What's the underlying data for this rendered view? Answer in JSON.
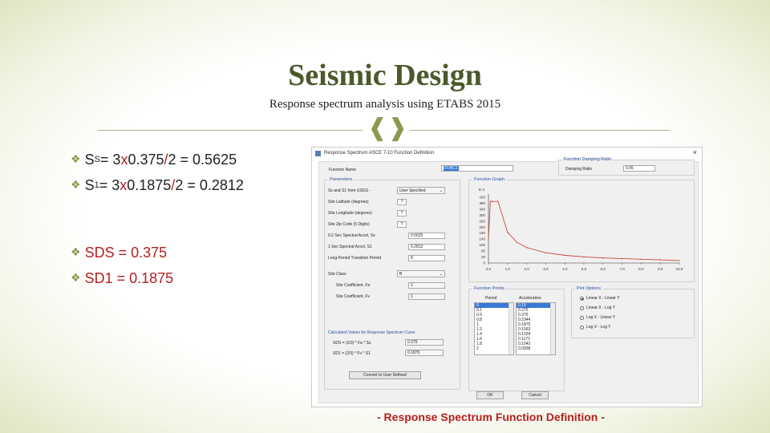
{
  "slide": {
    "title": "Seismic Design",
    "subtitle": "Response spectrum analysis using ETABS 2015",
    "divider_glyph": "❰❱"
  },
  "bullets": {
    "marker": "❖",
    "ss": {
      "label": "S",
      "sub": "S",
      "eq": " = 3 ",
      "x": "x",
      "v1": " 0.375",
      "slash": "/",
      "rest": "2 = 0.5625"
    },
    "s1": {
      "label": "S",
      "sub": "1",
      "eq": " = 3 ",
      "x": "x",
      "v1": " 0.1875",
      "slash": "/",
      "rest": "2 = 0.2812"
    },
    "sds": "SDS = 0.375",
    "sd1": "SD1 = 0.1875"
  },
  "dialog": {
    "title": "Response Spectrum ASCE 7-10 Function Definition",
    "close_glyph": "×",
    "function_name_label": "Function Name",
    "function_name_value": "FUNC1",
    "damping": {
      "group": "Function Damping Ratio",
      "label": "Damping Ratio",
      "value": "0.05"
    },
    "parameters": {
      "group": "Parameters",
      "rows": [
        {
          "label": "Ss and S1 from USGS -",
          "value": "User Specified"
        },
        {
          "label": "Site Latitude (degrees)",
          "value": "?"
        },
        {
          "label": "Site Longitude (degrees)",
          "value": "?"
        },
        {
          "label": "Site Zip Code (5 Digits)",
          "value": "?"
        },
        {
          "label": "0.2 Sec Spectral Accel, Ss",
          "value": "0.5625"
        },
        {
          "label": "1 Sec Spectral Accel, S1",
          "value": "0.2812"
        },
        {
          "label": "Long-Period Transition Period",
          "value": "8"
        },
        {
          "label": "Site Class",
          "value": "B"
        },
        {
          "label": "Site Coefficient, Fa",
          "value": "1"
        },
        {
          "label": "Site Coefficient, Fv",
          "value": "1"
        }
      ],
      "calc_label": "Calculated Values for Response Spectrum Curve",
      "sds_label": "SDS = (2/3) * Fa * Ss",
      "sds_value": "0.375",
      "sd1_label": "SD1 = (2/3) * Fv * S1",
      "sd1_value": "0.1875"
    },
    "graph": {
      "group": "Function Graph",
      "axis_unit": "E-3",
      "y_ticks": [
        "420",
        "380",
        "340",
        "300",
        "260",
        "220",
        "180",
        "140",
        "100",
        "60",
        "20",
        "0"
      ],
      "x_ticks": [
        "0.0",
        "1.0",
        "2.0",
        "3.0",
        "4.0",
        "5.0",
        "6.0",
        "7.0",
        "8.0",
        "9.0",
        "10.0"
      ]
    },
    "chart_data": {
      "type": "line",
      "title": "",
      "xlabel": "",
      "ylabel": "",
      "x": [
        0.0,
        0.1,
        0.2,
        0.5,
        1.0,
        1.5,
        2.0,
        3.0,
        4.0,
        5.0,
        6.0,
        7.0,
        8.0,
        9.0,
        10.0
      ],
      "y": [
        150,
        375,
        375,
        375,
        187.5,
        125,
        94,
        62.5,
        47,
        37.5,
        31,
        27,
        23,
        19,
        15
      ],
      "xlim": [
        0,
        10
      ],
      "ylim": [
        0,
        420
      ],
      "y_scale": 0.001
    },
    "points": {
      "group": "Function Points",
      "period_header": "Period",
      "accel_header": "Acceleration",
      "periods": [
        "0",
        "0.1",
        "0.5",
        "0.8",
        "1",
        "1.2",
        "1.4",
        "1.6",
        "1.8",
        "2"
      ],
      "accels": [
        "0.15",
        "0.375",
        "0.375",
        "0.2344",
        "0.1875",
        "0.1563",
        "0.1339",
        "0.1172",
        "0.1042",
        "0.0938"
      ]
    },
    "plot_options": {
      "group": "Plot Options",
      "options": [
        "Linear X - Linear Y",
        "Linear X - Log Y",
        "Log X - Linear Y",
        "Log X - Log Y"
      ],
      "selected": 0
    },
    "convert_button": "Convert to User Defined",
    "ok_button": "OK",
    "cancel_button": "Cancel"
  },
  "caption": "- Response Spectrum Function Definition -",
  "colors": {
    "accent": "#8a9a4a",
    "title": "#4a5a2a",
    "red": "#b51f1f",
    "selection": "#3a78d8"
  }
}
